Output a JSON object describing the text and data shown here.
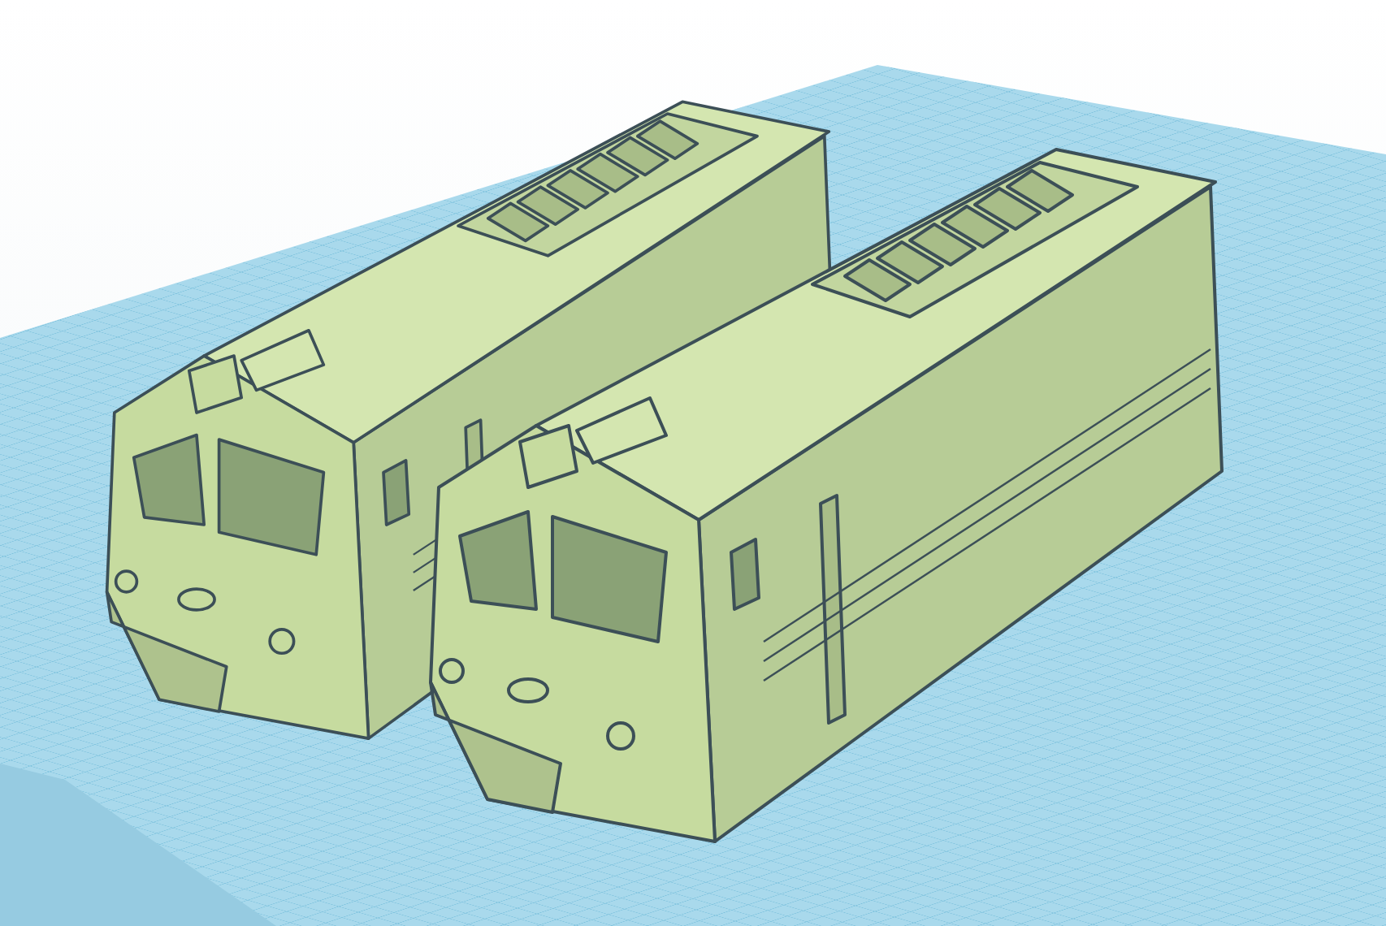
{
  "workplane": {
    "models": [
      {
        "kind": "locomotive"
      },
      {
        "kind": "locomotive"
      }
    ]
  }
}
